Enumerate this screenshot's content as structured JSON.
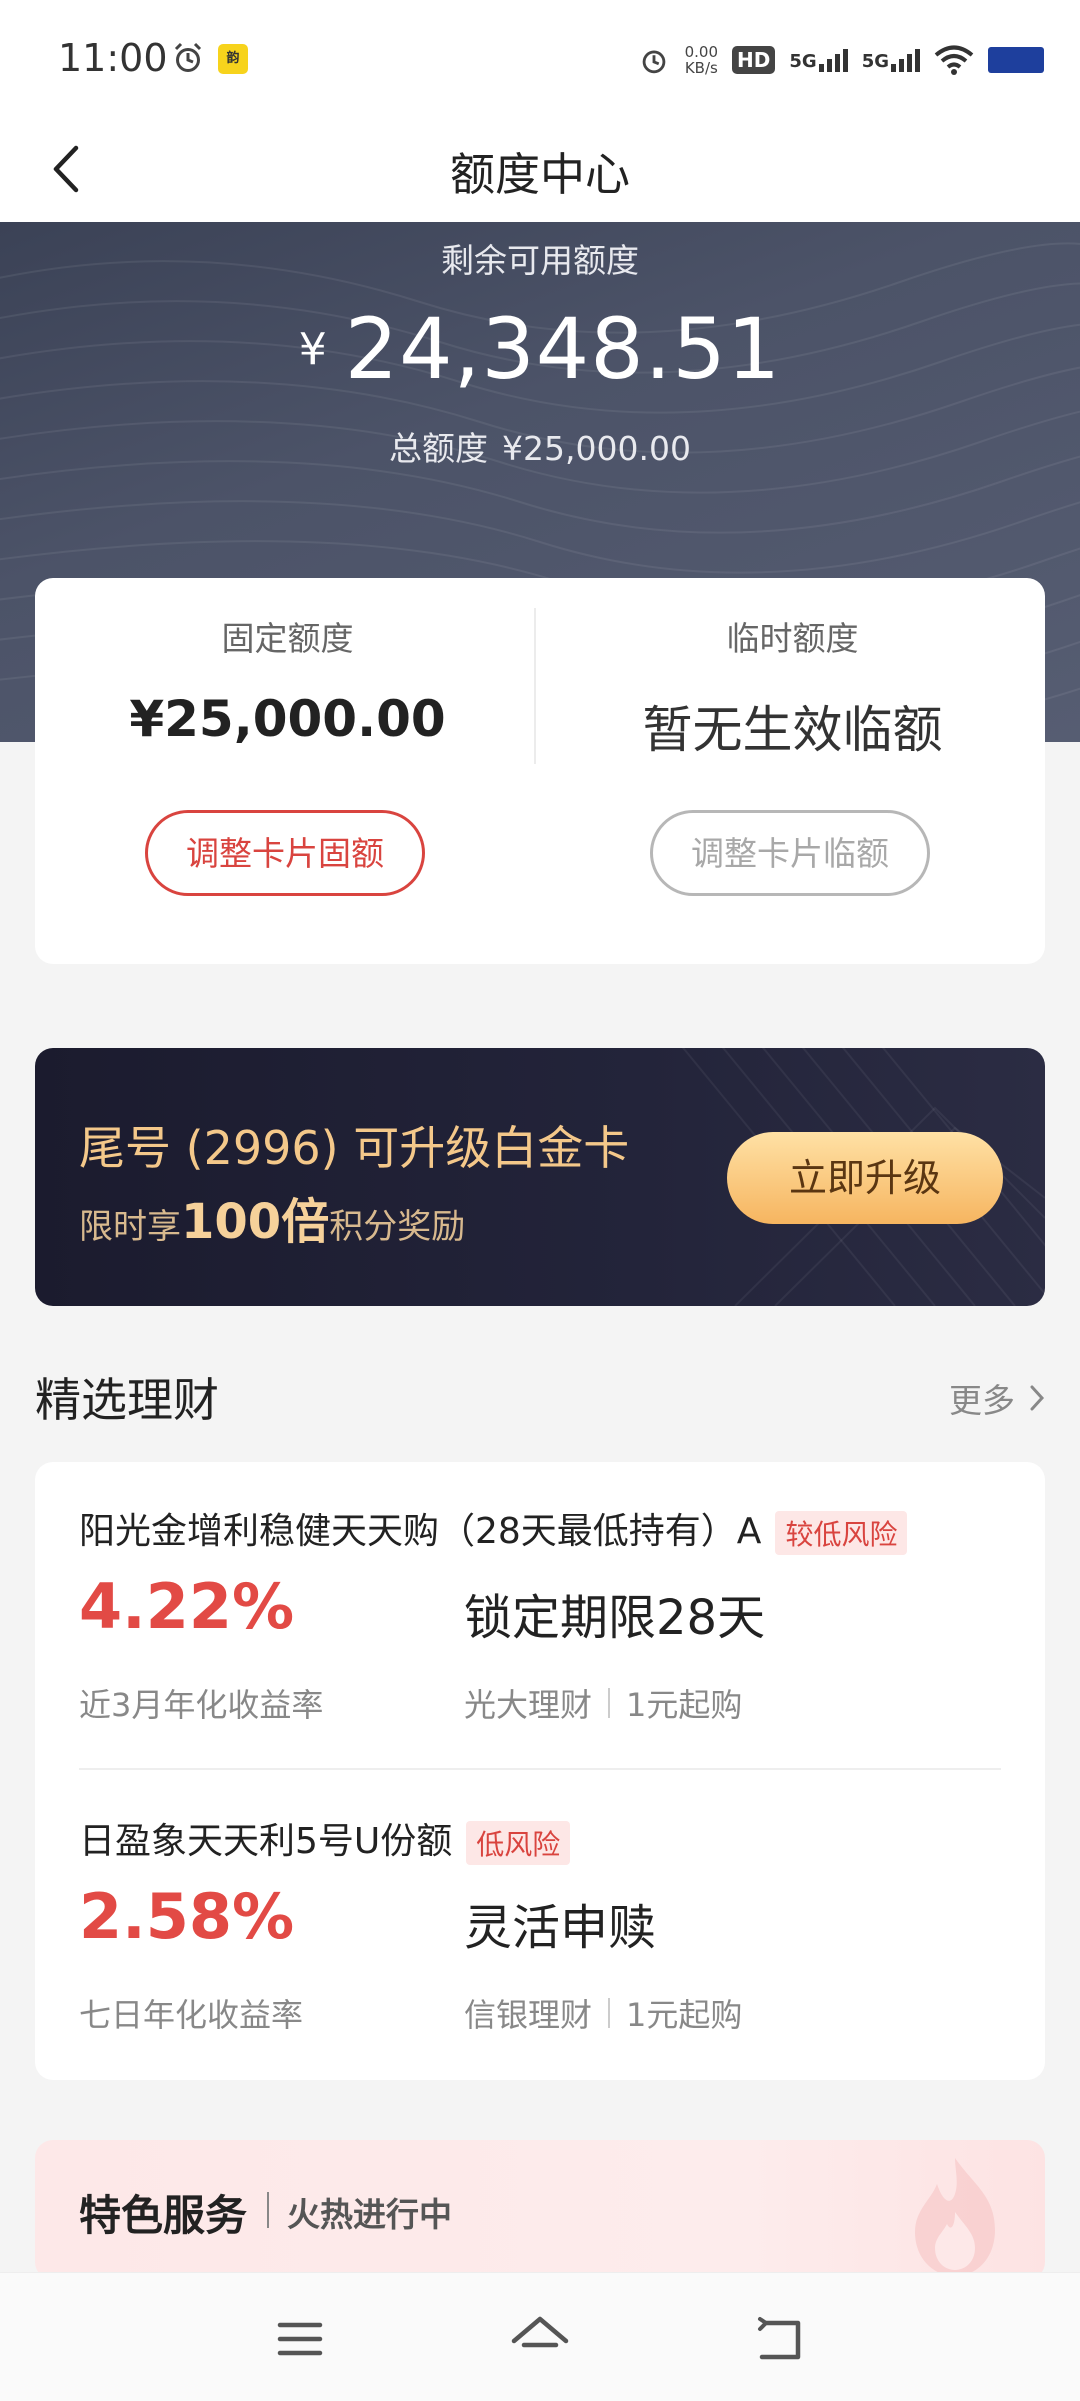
{
  "status_bar": {
    "time": "11:00",
    "badge_text": "韵",
    "net_speed_value": "0.00",
    "net_speed_unit": "KB/s",
    "hd_label": "HD",
    "signal1": "5G",
    "signal2": "5G"
  },
  "header": {
    "title": "额度中心"
  },
  "hero": {
    "label": "剩余可用额度",
    "currency": "¥",
    "amount": "24,348.51",
    "total_label": "总额度",
    "total_value": "¥25,000.00"
  },
  "credit": {
    "fixed": {
      "label": "固定额度",
      "value": "¥25,000.00",
      "button": "调整卡片固额"
    },
    "temp": {
      "label": "临时额度",
      "value": "暂无生效临额",
      "button": "调整卡片临额"
    }
  },
  "upgrade": {
    "title": "尾号 (2996) 可升级白金卡",
    "sub_prefix": "限时享",
    "sub_highlight": "100倍",
    "sub_suffix": "积分奖励",
    "button": "立即升级"
  },
  "wealth": {
    "section_title": "精选理财",
    "more": "更多",
    "products": [
      {
        "name": "阳光金增利稳健天天购（28天最低持有）A",
        "risk": "较低风险",
        "rate": "4.22%",
        "rate_label": "近3月年化收益率",
        "term": "锁定期限28天",
        "issuer": "光大理财",
        "min": "1元起购"
      },
      {
        "name": "日盈象天天利5号U份额",
        "risk": "低风险",
        "rate": "2.58%",
        "rate_label": "七日年化收益率",
        "term": "灵活申赎",
        "issuer": "信银理财",
        "min": "1元起购"
      }
    ]
  },
  "feature": {
    "title": "特色服务",
    "subtitle": "火热进行中"
  },
  "colors": {
    "accent_red": "#e24a45",
    "hero_bg": "#4c5368",
    "gold": "#f4c88a",
    "upgrade_bg": "#1b1b2e"
  },
  "icons": {
    "back": "back-arrow-icon",
    "more": "chevron-right-icon",
    "nav_menu": "menu-icon",
    "nav_home": "home-icon",
    "nav_back": "back-icon"
  }
}
